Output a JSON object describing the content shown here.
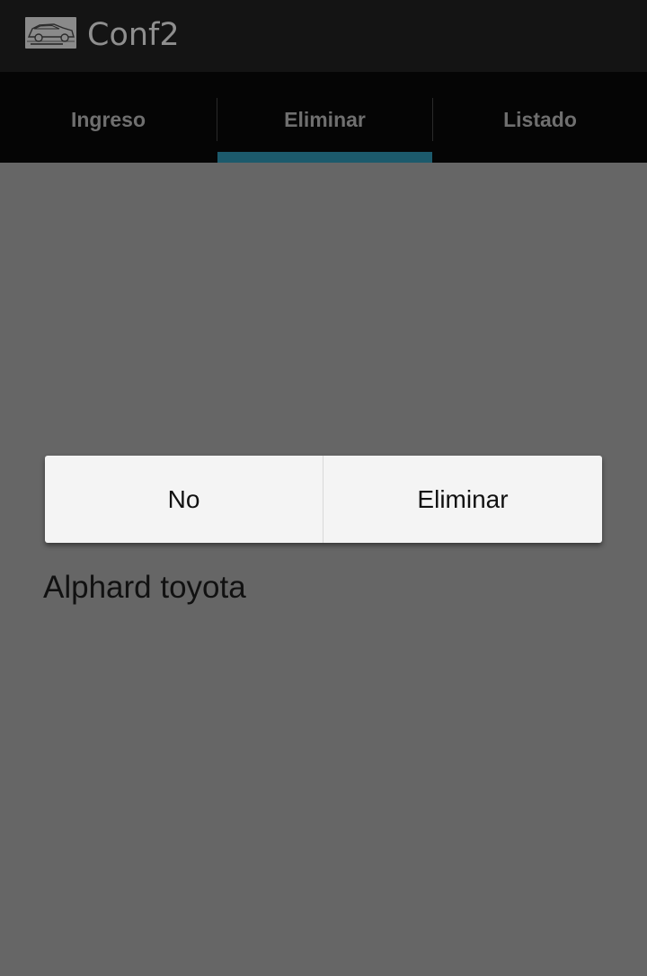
{
  "action_bar": {
    "icon": "car-logo-icon",
    "title": "Conf2"
  },
  "tabs": [
    {
      "label": "Ingreso",
      "selected": false
    },
    {
      "label": "Eliminar",
      "selected": true
    },
    {
      "label": "Listado",
      "selected": false
    }
  ],
  "colors": {
    "tab_indicator": "#1c5a6c",
    "background": "#666666"
  },
  "dialog_buttons": {
    "no_label": "No",
    "delete_label": "Eliminar"
  },
  "item": {
    "text": "Alphard toyota"
  }
}
